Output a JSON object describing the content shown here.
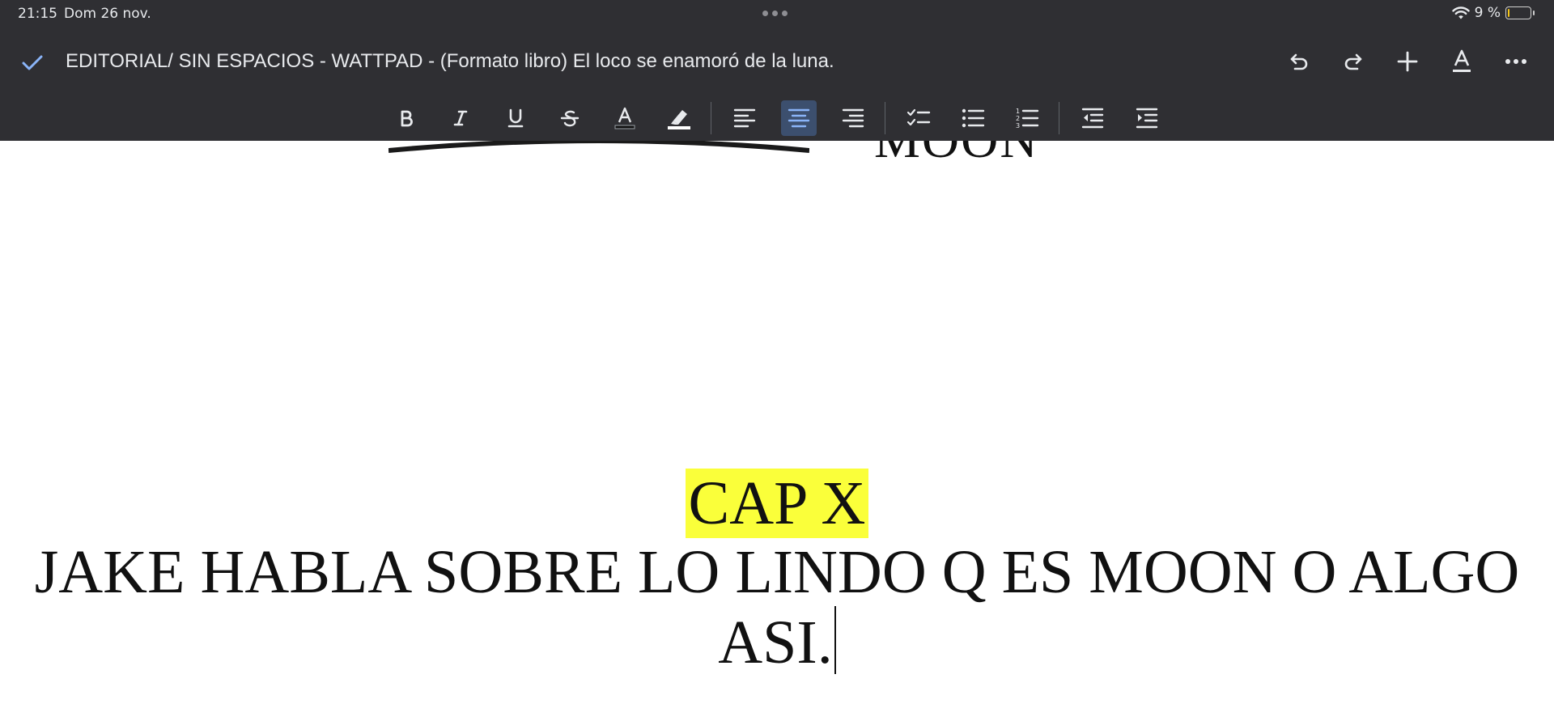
{
  "status": {
    "time": "21:15",
    "date": "Dom 26 nov.",
    "battery": "9 %",
    "battery_level": 0.09
  },
  "header": {
    "title": "EDITORIAL/ SIN ESPACIOS - WATTPAD - (Formato libro) El loco se enamoró de la luna.",
    "done_icon": "check-icon",
    "actions": [
      "undo-icon",
      "redo-icon",
      "plus-icon",
      "text-format-icon",
      "more-icon"
    ]
  },
  "toolbar": {
    "buttons": [
      "bold",
      "italic",
      "underline",
      "strikethrough",
      "text-color",
      "highlight",
      "align-left",
      "align-center",
      "align-right",
      "checklist",
      "bulleted-list",
      "numbered-list",
      "decrease-indent",
      "increase-indent"
    ],
    "active": "align-center"
  },
  "document": {
    "scrolled_heading_fragment": "MOON",
    "chapter": "CAP X",
    "paragraph_line1": "JAKE HABLA SOBRE LO LINDO Q ES MOON O ALGO",
    "paragraph_line2": "ASI.",
    "highlight_color": "#faff3a"
  }
}
